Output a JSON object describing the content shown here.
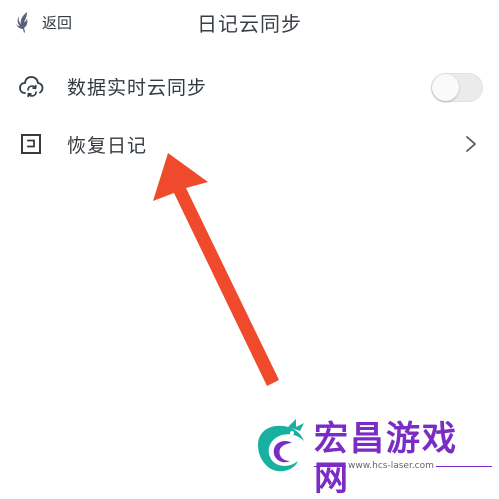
{
  "header": {
    "back_label": "返回",
    "title": "日记云同步",
    "back_icon": "feather-back-icon"
  },
  "settings": [
    {
      "icon": "cloud-sync-icon",
      "label": "数据实时云同步",
      "control": "toggle",
      "toggle_on": false
    },
    {
      "icon": "restore-box-icon",
      "label": "恢复日记",
      "control": "chevron"
    }
  ],
  "annotation": {
    "arrow_color": "#f04a2c",
    "points_to": "恢复日记"
  },
  "watermark": {
    "text": "宏昌游戏网",
    "url": "www.hcs-laser.com",
    "color": "#7a2cc4"
  }
}
